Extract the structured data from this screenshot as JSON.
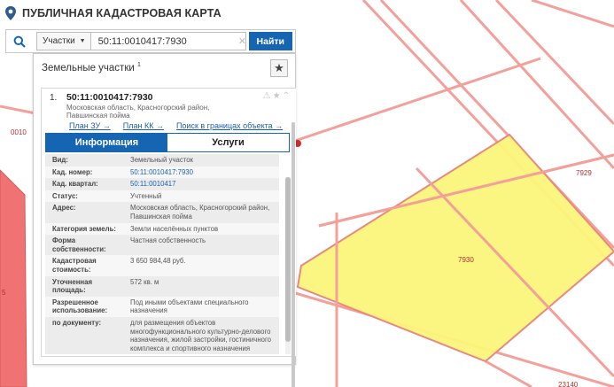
{
  "app": {
    "title": "ПУБЛИЧНАЯ КАДАСТРОВАЯ КАРТА"
  },
  "search": {
    "type_label": "Участки",
    "query": "50:11:0010417:7930",
    "submit_label": "Найти"
  },
  "panel": {
    "title": "Земельные участки",
    "count": "1"
  },
  "result": {
    "number": "1.",
    "cadastral_number": "50:11:0010417:7930",
    "address_line1": "Московская область, Красногорский район,",
    "address_line2": "Павшинская пойма",
    "links": [
      "План ЗУ →",
      "План КК →",
      "Поиск в границах объекта →"
    ]
  },
  "tabs": [
    {
      "label": "Информация",
      "active": true
    },
    {
      "label": "Услуги",
      "active": false
    }
  ],
  "attributes": [
    {
      "label": "Вид:",
      "value": "Земельный участок"
    },
    {
      "label": "Кад. номер:",
      "value": "50:11:0010417:7930",
      "link": true
    },
    {
      "label": "Кад. квартал:",
      "value": "50:11:0010417",
      "link": true
    },
    {
      "label": "Статус:",
      "value": "Учтенный"
    },
    {
      "label": "Адрес:",
      "value": "Московская область, Красногорский район, Павшинская пойма"
    },
    {
      "label": "Категория земель:",
      "value": "Земли населённых пунктов"
    },
    {
      "label": "Форма собственности:",
      "value": "Частная собственность"
    },
    {
      "label": "Кадастровая стоимость:",
      "value": "3 650 984,48 руб."
    },
    {
      "label": "Уточненная площадь:",
      "value": "572 кв. м"
    },
    {
      "label": "Разрешенное использование:",
      "value": "Под иными объектами специального назначения"
    },
    {
      "label": "по документу:",
      "value": "для размещения объектов многофункционального культурно-делового назначения, жилой застройки, гостиничного комплекса и спортивного назначения"
    }
  ],
  "map": {
    "labels": [
      "0010",
      "7929",
      "7930",
      "5",
      "23140"
    ],
    "parcel_fill": "#fbf57a",
    "parcel_stroke": "#e8897f",
    "boundary_color": "#f4a09a",
    "neighbor_fill": "#f07272"
  },
  "colors": {
    "accent": "#1565b3",
    "link": "#1a5fb4"
  }
}
